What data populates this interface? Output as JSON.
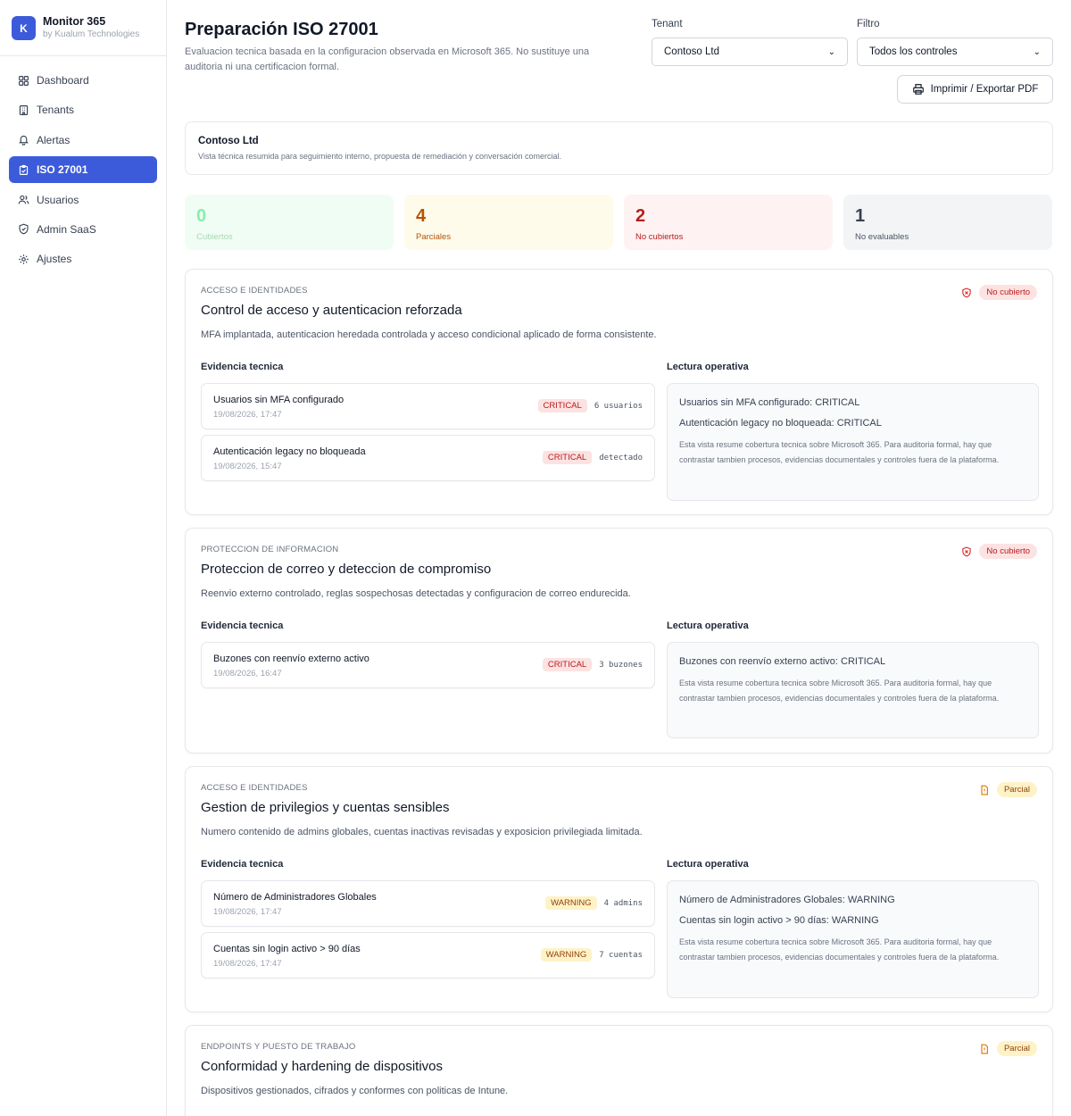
{
  "brand": {
    "logo_letter": "K",
    "name": "Monitor 365",
    "sub": "by Kualum Technologies"
  },
  "nav": [
    {
      "label": "Dashboard",
      "icon": "grid-icon"
    },
    {
      "label": "Tenants",
      "icon": "building-icon"
    },
    {
      "label": "Alertas",
      "icon": "bell-icon"
    },
    {
      "label": "ISO 27001",
      "icon": "clipboard-icon",
      "active": true
    },
    {
      "label": "Usuarios",
      "icon": "users-icon"
    },
    {
      "label": "Admin SaaS",
      "icon": "shield-icon"
    },
    {
      "label": "Ajustes",
      "icon": "gear-icon"
    }
  ],
  "header": {
    "title": "Preparación ISO 27001",
    "description": "Evaluacion tecnica basada en la configuracion observada en Microsoft 365. No sustituye una auditoria ni una certificacion formal."
  },
  "tenant": {
    "label": "Tenant",
    "value": "Contoso Ltd"
  },
  "filter": {
    "label": "Filtro",
    "value": "Todos los controles"
  },
  "print_label": "Imprimir / Exportar PDF",
  "summary": {
    "title": "Contoso Ltd",
    "subtitle": "Vista técnica resumida para seguimiento interno, propuesta de remediación y conversación comercial."
  },
  "stats": [
    {
      "value": "0",
      "label": "Cubiertos"
    },
    {
      "value": "4",
      "label": "Parciales"
    },
    {
      "value": "2",
      "label": "No cubiertos"
    },
    {
      "value": "1",
      "label": "No evaluables"
    }
  ],
  "labels": {
    "evidence": "Evidencia tecnica",
    "reading": "Lectura operativa"
  },
  "note": "Esta vista resume cobertura tecnica sobre Microsoft 365. Para auditoria formal, hay que contrastar tambien procesos, evidencias documentales y controles fuera de la plataforma.",
  "controls": [
    {
      "category": "ACCESO E IDENTIDADES",
      "title": "Control de acceso y autenticacion reforzada",
      "description": "MFA implantada, autenticacion heredada controlada y acceso condicional aplicado de forma consistente.",
      "status": "No cubierto",
      "status_icon": "shield-x-icon",
      "evidence": [
        {
          "name": "Usuarios sin MFA configurado",
          "date": "19/08/2026, 17:47",
          "severity": "CRITICAL",
          "value": "6 usuarios"
        },
        {
          "name": "Autenticación legacy no bloqueada",
          "date": "19/08/2026, 15:47",
          "severity": "CRITICAL",
          "value": "detectado"
        }
      ],
      "reading": [
        "Usuarios sin MFA configurado: CRITICAL",
        "Autenticación legacy no bloqueada: CRITICAL"
      ]
    },
    {
      "category": "PROTECCION DE INFORMACION",
      "title": "Proteccion de correo y deteccion de compromiso",
      "description": "Reenvio externo controlado, reglas sospechosas detectadas y configuracion de correo endurecida.",
      "status": "No cubierto",
      "status_icon": "shield-x-icon",
      "evidence": [
        {
          "name": "Buzones con reenvío externo activo",
          "date": "19/08/2026, 16:47",
          "severity": "CRITICAL",
          "value": "3 buzones"
        }
      ],
      "reading": [
        "Buzones con reenvío externo activo: CRITICAL"
      ]
    },
    {
      "category": "ACCESO E IDENTIDADES",
      "title": "Gestion de privilegios y cuentas sensibles",
      "description": "Numero contenido de admins globales, cuentas inactivas revisadas y exposicion privilegiada limitada.",
      "status": "Parcial",
      "status_icon": "file-alert-icon",
      "evidence": [
        {
          "name": "Número de Administradores Globales",
          "date": "19/08/2026, 17:47",
          "severity": "WARNING",
          "value": "4 admins"
        },
        {
          "name": "Cuentas sin login activo > 90 días",
          "date": "19/08/2026, 17:47",
          "severity": "WARNING",
          "value": "7 cuentas"
        }
      ],
      "reading": [
        "Número de Administradores Globales: WARNING",
        "Cuentas sin login activo > 90 días: WARNING"
      ]
    },
    {
      "category": "ENDPOINTS Y PUESTO DE TRABAJO",
      "title": "Conformidad y hardening de dispositivos",
      "description": "Dispositivos gestionados, cifrados y conformes con politicas de Intune.",
      "status": "Parcial",
      "status_icon": "file-alert-icon",
      "evidence": [],
      "reading": []
    }
  ]
}
